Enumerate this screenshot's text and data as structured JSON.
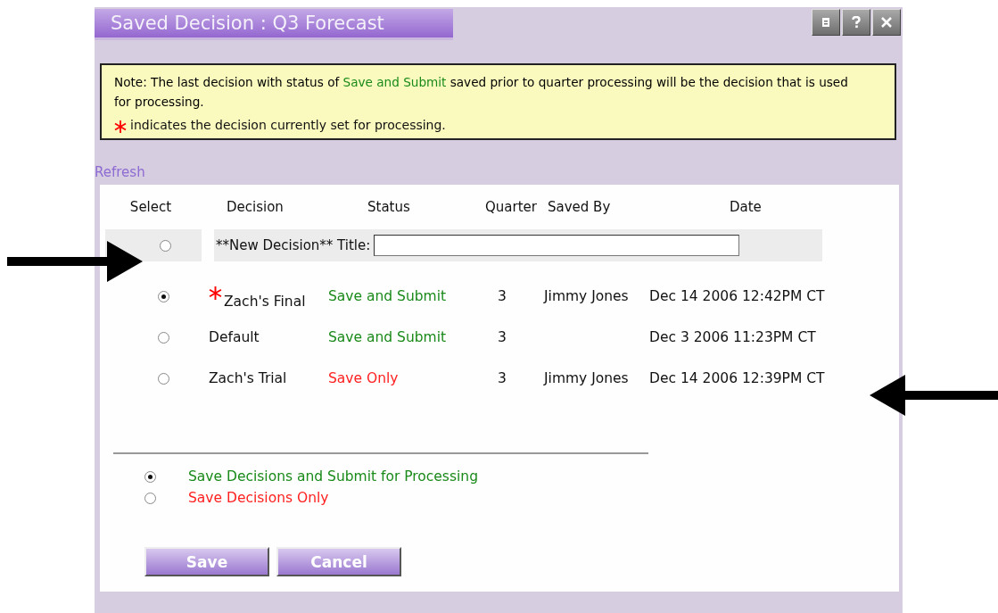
{
  "window": {
    "title": "Saved Decision : Q3 Forecast"
  },
  "note": {
    "parts": [
      {
        "text": "Note: The last decision with status of ",
        "kind": "plain"
      },
      {
        "text": "Save and Submit",
        "kind": "submit"
      },
      {
        "text": " saved prior to quarter processing will be the decision that is used for processing.",
        "kind": "plain"
      }
    ],
    "legend": "indicates the decision currently set for processing."
  },
  "refresh_link": "Refresh",
  "table": {
    "columns": [
      "Select",
      "Decision",
      "Status",
      "Quarter",
      "Saved By",
      "Date"
    ],
    "new_row": {
      "selected": false,
      "label": "**New Decision** Title:"
    },
    "rows": [
      {
        "selected": true,
        "current": true,
        "decision": "Zach's Final",
        "status": "Save and Submit",
        "kind": "submit",
        "quarter": "3",
        "saved_by": "Jimmy Jones",
        "date": "Dec 14 2006 12:42PM CT"
      },
      {
        "selected": false,
        "current": false,
        "decision": "Default",
        "status": "Save and Submit",
        "kind": "submit",
        "quarter": "3",
        "date": "Dec 3 2006 11:23PM CT"
      },
      {
        "selected": false,
        "current": false,
        "decision": "Zach's Trial",
        "status": "Save Only",
        "kind": "save_only",
        "quarter": "3",
        "saved_by": "Jimmy Jones",
        "date": "Dec 14 2006 12:39PM CT"
      }
    ]
  },
  "save_options": [
    {
      "label": "Save Decisions and Submit for Processing",
      "kind": "submit",
      "selected": true
    },
    {
      "label": "Save Decisions Only",
      "kind": "save_only",
      "selected": false
    }
  ],
  "buttons": [
    "Save",
    "Cancel"
  ]
}
